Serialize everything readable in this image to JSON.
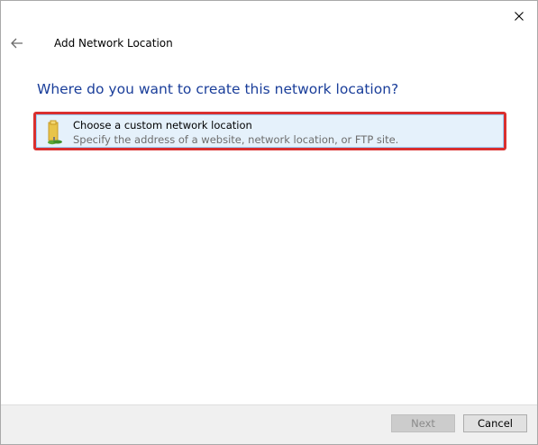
{
  "window": {
    "title": "Add Network Location"
  },
  "main": {
    "heading": "Where do you want to create this network location?",
    "options": [
      {
        "title": "Choose a custom network location",
        "description": "Specify the address of a website, network location, or FTP site.",
        "icon": "network-folder-icon"
      }
    ]
  },
  "footer": {
    "next_label": "Next",
    "cancel_label": "Cancel"
  },
  "colors": {
    "heading": "#1a3e9a",
    "highlight_border": "#d9302f",
    "selection_bg": "#e5f1fb"
  }
}
